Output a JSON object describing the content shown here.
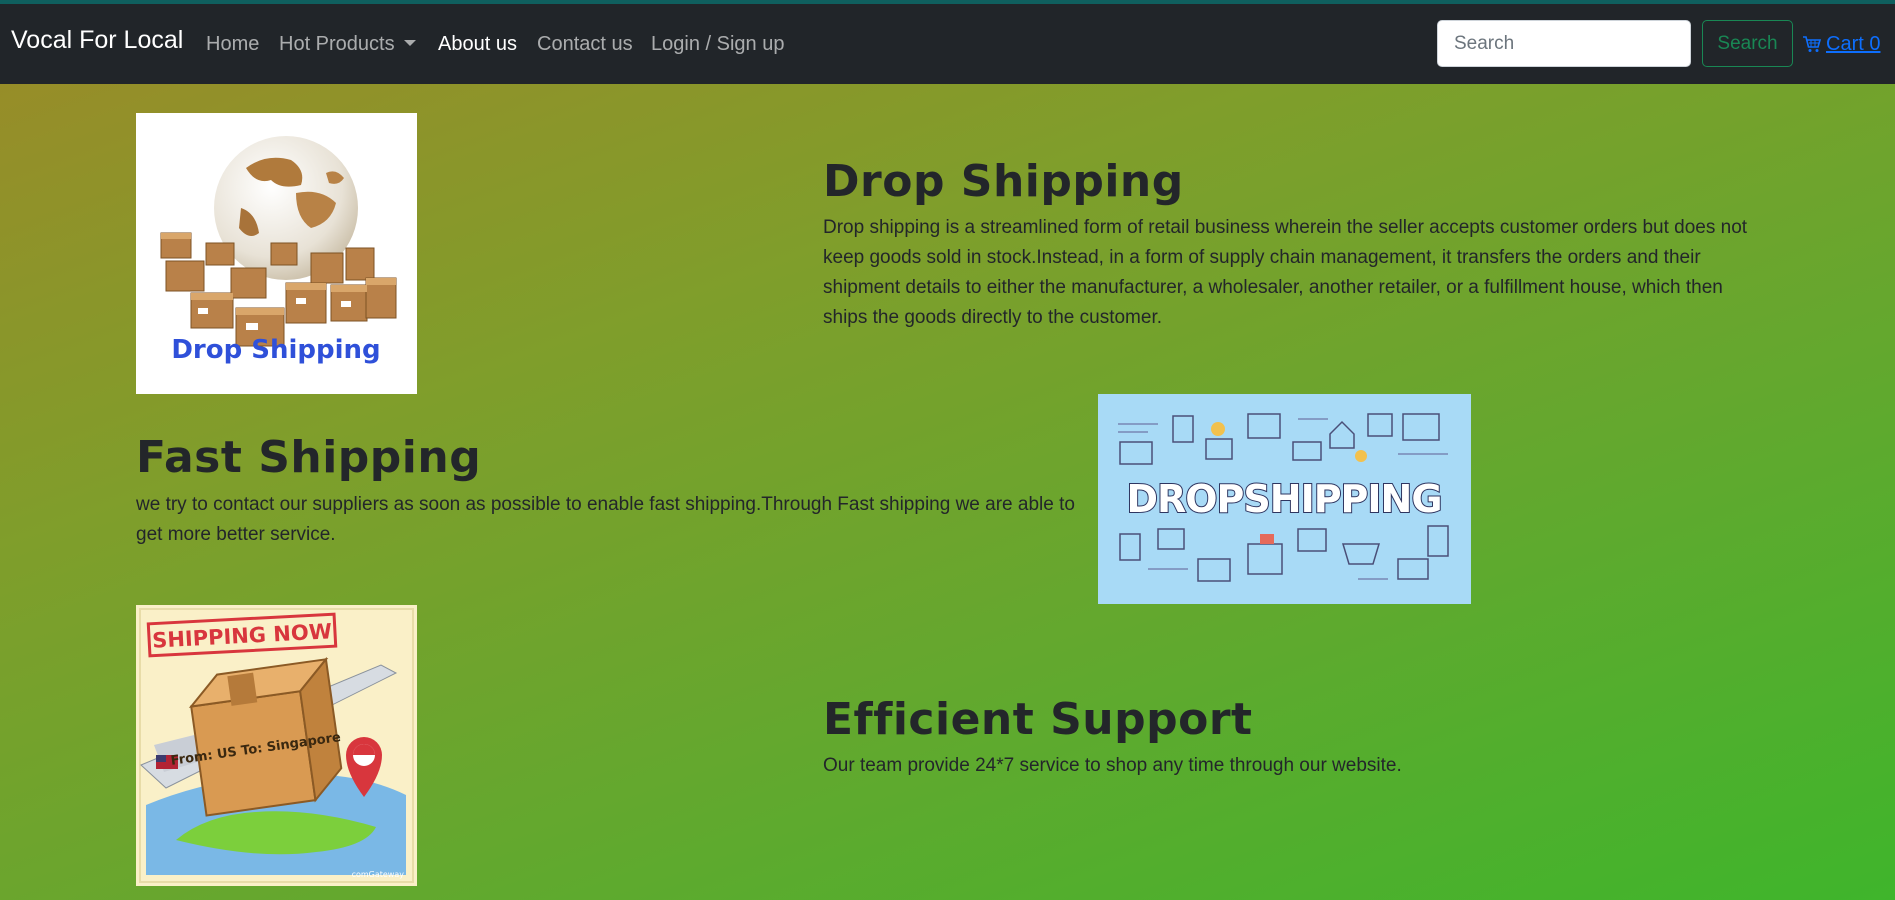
{
  "nav": {
    "brand": "Vocal For Local",
    "items": [
      {
        "label": "Home"
      },
      {
        "label": "Hot Products"
      },
      {
        "label": "About us"
      },
      {
        "label": "Contact us"
      },
      {
        "label": "Login / Sign up"
      }
    ],
    "search_placeholder": "Search",
    "search_button": "Search",
    "cart_label": "Cart 0"
  },
  "sections": [
    {
      "title": "Drop Shipping",
      "text": "Drop shipping is a streamlined form of retail business wherein the seller accepts customer orders but does not keep goods sold in stock.Instead, in a form of supply chain management, it transfers the orders and their shipment details to either the manufacturer, a wholesaler, another retailer, or a fulfillment house, which then ships the goods directly to the customer.",
      "image_caption": "Drop Shipping"
    },
    {
      "title": "Fast Shipping",
      "text": "we try to contact our suppliers as soon as possible to enable fast shipping.Through Fast shipping we are able to get more better service.",
      "image_caption": "DROPSHIPPING"
    },
    {
      "title": "Efficient Support",
      "text": "Our team provide 24*7 service to shop any time through our website.",
      "image_caption": "SHIPPING NOW",
      "image_subcaption": "From: US To: Singapore",
      "image_brand": "comGateway"
    }
  ],
  "colors": {
    "navbar": "#212529",
    "accent_green": "#198754",
    "link_blue": "#0d6efd",
    "caption_blue": "#2f50d9",
    "stamp_red": "#d8363d"
  }
}
